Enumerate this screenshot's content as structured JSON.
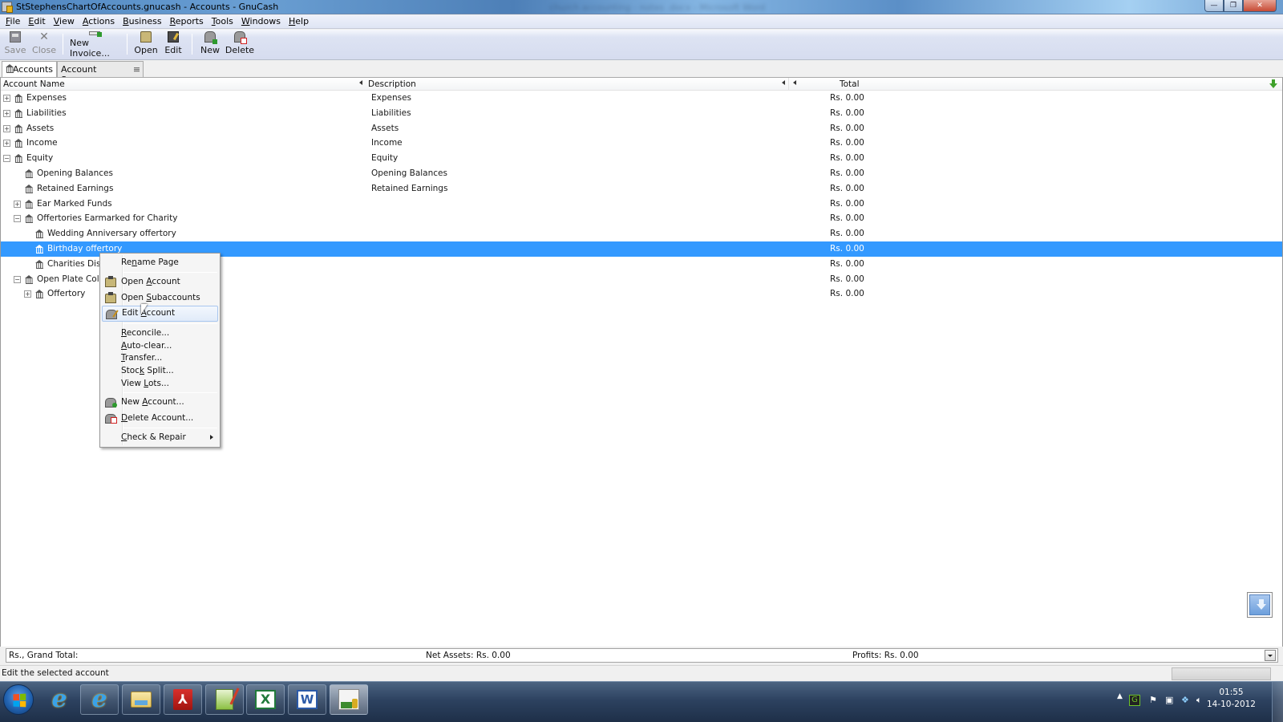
{
  "window": {
    "title": "StStephensChartOfAccounts.gnucash - Accounts - GnuCash",
    "background_title": "church accounting - notes .docx - Microsoft Word",
    "controls": {
      "minimize": "—",
      "restore": "❐",
      "close": "✕"
    }
  },
  "menubar": {
    "items": [
      {
        "label": "File",
        "mnemonic": "F",
        "rest": "ile"
      },
      {
        "label": "Edit",
        "mnemonic": "E",
        "rest": "dit"
      },
      {
        "label": "View",
        "mnemonic": "V",
        "rest": "iew"
      },
      {
        "label": "Actions",
        "mnemonic": "A",
        "rest": "ctions"
      },
      {
        "label": "Business",
        "mnemonic": "B",
        "rest": "usiness"
      },
      {
        "label": "Reports",
        "mnemonic": "R",
        "rest": "eports"
      },
      {
        "label": "Tools",
        "mnemonic": "T",
        "rest": "ools"
      },
      {
        "label": "Windows",
        "mnemonic": "W",
        "rest": "indows"
      },
      {
        "label": "Help",
        "mnemonic": "H",
        "rest": "elp"
      }
    ]
  },
  "toolbar": {
    "save": {
      "label": "Save",
      "icon": "save-icon",
      "enabled": false
    },
    "close": {
      "label": "Close",
      "icon": "close-icon",
      "enabled": false
    },
    "new_invoice": {
      "label": "New Invoice...",
      "icon": "new-invoice-icon",
      "enabled": true
    },
    "open": {
      "label": "Open",
      "icon": "open-folder-icon",
      "enabled": true
    },
    "edit": {
      "label": "Edit",
      "icon": "edit-account-icon",
      "enabled": true
    },
    "new": {
      "label": "New",
      "icon": "new-account-icon",
      "enabled": true
    },
    "delete": {
      "label": "Delete",
      "icon": "delete-account-icon",
      "enabled": true
    }
  },
  "tabs": [
    {
      "label": "Accounts",
      "active": true,
      "icon": "bank-icon"
    },
    {
      "label": "Account Summary",
      "active": false,
      "icon": "close-tab-icon"
    }
  ],
  "tree": {
    "columns": {
      "name": "Account Name",
      "description": "Description",
      "total": "Total"
    },
    "rows": [
      {
        "name": "Expenses",
        "description": "Expenses",
        "total": "Rs. 0.00",
        "depth": 0,
        "expander": "+"
      },
      {
        "name": "Liabilities",
        "description": "Liabilities",
        "total": "Rs. 0.00",
        "depth": 0,
        "expander": "+"
      },
      {
        "name": "Assets",
        "description": "Assets",
        "total": "Rs. 0.00",
        "depth": 0,
        "expander": "+"
      },
      {
        "name": "Income",
        "description": "Income",
        "total": "Rs. 0.00",
        "depth": 0,
        "expander": "+"
      },
      {
        "name": "Equity",
        "description": "Equity",
        "total": "Rs. 0.00",
        "depth": 0,
        "expander": "−"
      },
      {
        "name": "Opening Balances",
        "description": "Opening Balances",
        "total": "Rs. 0.00",
        "depth": 1,
        "expander": ""
      },
      {
        "name": "Retained Earnings",
        "description": "Retained Earnings",
        "total": "Rs. 0.00",
        "depth": 1,
        "expander": ""
      },
      {
        "name": "Ear Marked Funds",
        "description": "",
        "total": "Rs. 0.00",
        "depth": 1,
        "expander": "+"
      },
      {
        "name": "Offertories Earmarked for Charity",
        "description": "",
        "total": "Rs. 0.00",
        "depth": 1,
        "expander": "−"
      },
      {
        "name": "Wedding Anniversary offertory",
        "description": "",
        "total": "Rs. 0.00",
        "depth": 2,
        "expander": ""
      },
      {
        "name": "Birthday offertory",
        "description": "",
        "total": "Rs. 0.00",
        "depth": 2,
        "expander": "",
        "selected": true
      },
      {
        "name": "Charities Disbursement",
        "description": "",
        "total": "Rs. 0.00",
        "depth": 2,
        "expander": ""
      },
      {
        "name": "Open Plate Collection",
        "description": "",
        "total": "Rs. 0.00",
        "depth": 1,
        "expander": "−"
      },
      {
        "name": "Offertory",
        "description": "",
        "total": "Rs. 0.00",
        "depth": 2,
        "expander": "+"
      }
    ]
  },
  "context_menu": {
    "items": [
      {
        "pre": "Re",
        "u": "n",
        "post": "ame Page",
        "icon": ""
      },
      {
        "pre": "Open ",
        "u": "A",
        "post": "ccount",
        "icon": "open-folder-icon"
      },
      {
        "pre": "Open ",
        "u": "S",
        "post": "ubaccounts",
        "icon": "open-folder-icon"
      },
      {
        "pre": "Edit ",
        "u": "A",
        "post": "ccount",
        "icon": "edit-account-icon",
        "hover": true
      },
      {
        "pre": "",
        "u": "R",
        "post": "econcile...",
        "icon": ""
      },
      {
        "pre": "",
        "u": "A",
        "post": "uto-clear...",
        "icon": ""
      },
      {
        "pre": "",
        "u": "T",
        "post": "ransfer...",
        "icon": ""
      },
      {
        "pre": "Stoc",
        "u": "k",
        "post": " Split...",
        "icon": ""
      },
      {
        "pre": "View ",
        "u": "L",
        "post": "ots...",
        "icon": ""
      },
      {
        "pre": "New ",
        "u": "A",
        "post": "ccount...",
        "icon": "new-account-icon"
      },
      {
        "pre": "",
        "u": "D",
        "post": "elete Account...",
        "icon": "delete-account-icon"
      },
      {
        "pre": "",
        "u": "C",
        "post": "heck & Repair",
        "icon": "",
        "submenu": true
      }
    ]
  },
  "summary": {
    "grand_total_label": "Rs., Grand Total:",
    "net_assets": "Net Assets: Rs. 0.00",
    "profits": "Profits: Rs. 0.00"
  },
  "statusbar": {
    "message": "Edit the selected account"
  },
  "taskbar": {
    "apps": [
      {
        "name": "internet-explorer-pinned"
      },
      {
        "name": "internet-explorer"
      },
      {
        "name": "windows-explorer"
      },
      {
        "name": "adobe-reader"
      },
      {
        "name": "notepad-editor"
      },
      {
        "name": "microsoft-excel"
      },
      {
        "name": "microsoft-word"
      },
      {
        "name": "gnucash",
        "active": true
      }
    ],
    "clock": {
      "time": "01:55",
      "date": "14-10-2012"
    }
  }
}
